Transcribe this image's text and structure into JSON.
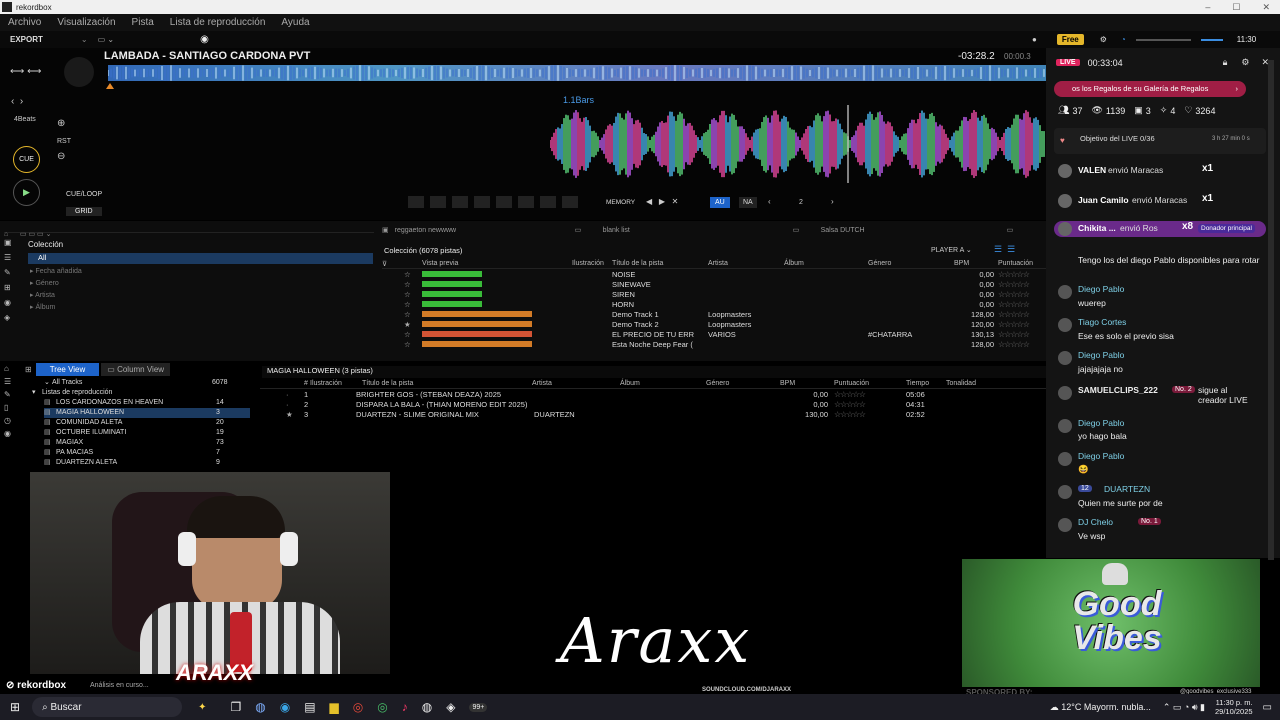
{
  "window": {
    "title": "rekordbox",
    "controls": [
      "–",
      "☐",
      "✕"
    ]
  },
  "menu": [
    "Archivo",
    "Visualización",
    "Pista",
    "Lista de reproducción",
    "Ayuda"
  ],
  "toolbar": {
    "mode": "EXPORT",
    "badge": "Free",
    "clock": "11:30"
  },
  "deck": {
    "track_title": "LAMBADA - SANTIAGO CARDONA PVT",
    "remaining": "-03:28.2",
    "elapsed": "00:00.3",
    "bars_label": "1.1Bars",
    "beats_label": "4Beats",
    "rst": "RST",
    "cue_label": "CUE",
    "cue_loop": "CUE/LOOP",
    "grid": "GRID",
    "memory": "MEMORY",
    "au": "AU",
    "na": "NA",
    "page": "2"
  },
  "collection": {
    "title": "Colección",
    "items": [
      "All",
      "Fecha añadida",
      "Género",
      "Artista",
      "Álbum"
    ],
    "tabs": [
      "reggaeton newwww",
      "blank list",
      "Salsa DUTCH"
    ],
    "count_label": "Colección (6078 pistas)",
    "player": "PLAYER A",
    "columns": [
      "Vista previa",
      "Ilustración",
      "Título de la pista",
      "Artista",
      "Álbum",
      "Género",
      "BPM",
      "Puntuación"
    ],
    "rows": [
      {
        "title": "NOISE",
        "artist": "",
        "genre": "",
        "bpm": "0,00",
        "wave": "#3ecf3e"
      },
      {
        "title": "SINEWAVE",
        "artist": "",
        "genre": "",
        "bpm": "0,00",
        "wave": "#3ecf3e"
      },
      {
        "title": "SIREN",
        "artist": "",
        "genre": "",
        "bpm": "0,00",
        "wave": "#3ecf3e"
      },
      {
        "title": "HORN",
        "artist": "",
        "genre": "",
        "bpm": "0,00",
        "wave": "#3ecf3e"
      },
      {
        "title": "Demo Track 1",
        "artist": "Loopmasters",
        "genre": "",
        "bpm": "128,00",
        "wave": "#e8872a"
      },
      {
        "title": "Demo Track 2",
        "artist": "Loopmasters",
        "genre": "",
        "bpm": "120,00",
        "wave": "#e8872a"
      },
      {
        "title": "EL PRECIO DE TU ERR",
        "artist": "VARIOS",
        "genre": "#CHATARRA",
        "bpm": "130,13",
        "wave": "#e85c3a"
      },
      {
        "title": "Esta Noche Deep Fear (",
        "artist": "",
        "genre": "",
        "bpm": "128,00",
        "wave": "#e8872a"
      }
    ]
  },
  "playlists": {
    "tree_view": "Tree View",
    "column_view": "Column View",
    "all_tracks": "All Tracks",
    "all_count": "6078",
    "lists_label": "Listas de reproducción",
    "items": [
      {
        "name": "LOS CARDONAZOS EN HEAVEN",
        "count": "14"
      },
      {
        "name": "MAGIA HALLOWEEN",
        "count": "3"
      },
      {
        "name": "COMUNIDAD ALETA",
        "count": "20"
      },
      {
        "name": "OCTUBRE ILUMINATI",
        "count": "19"
      },
      {
        "name": "MAGIAX",
        "count": "73"
      },
      {
        "name": "PA MACIAS",
        "count": "7"
      },
      {
        "name": "DUARTEZN ALETA",
        "count": "9"
      }
    ],
    "current": "MAGIA HALLOWEEN (3 pistas)",
    "columns": [
      "#",
      "Ilustración",
      "Título de la pista",
      "Artista",
      "Álbum",
      "Género",
      "BPM",
      "Puntuación",
      "Tiempo",
      "Tonalidad"
    ],
    "rows": [
      {
        "n": "1",
        "title": "BRIGHTER GOS - (STEBAN DEAZA) 2025",
        "artist": "",
        "bpm": "0,00",
        "time": "05:06"
      },
      {
        "n": "2",
        "title": "DISPARA LA BALA - (THIAN MORENO EDIT 2025)",
        "artist": "",
        "bpm": "0,00",
        "time": "04:31"
      },
      {
        "n": "3",
        "title": "DUARTEZN - SLIME ORIGINAL MIX",
        "artist": "DUARTEZN",
        "bpm": "130,00",
        "time": "02:52"
      }
    ]
  },
  "live": {
    "badge": "LIVE",
    "timer": "00:33:04",
    "banner": "os los Regalos de su Galería de Regalos",
    "stats": [
      "37",
      "1139",
      "3",
      "4",
      "3264"
    ],
    "objective": "Objetivo del LIVE 0/36",
    "objective_time": "3 h 27 min 0 s",
    "gifts": [
      {
        "user": "VALEN",
        "text": "envió Maracas",
        "mult": "x1"
      },
      {
        "user": "Juan Camilo",
        "text": "envió Maracas",
        "mult": "x1"
      },
      {
        "user": "Chikita ...",
        "text": "envió Ros",
        "mult": "x8",
        "tag": "Donador principal"
      }
    ],
    "chat": [
      {
        "name": "",
        "text": "Tengo los del diego Pablo disponibles para rotar"
      },
      {
        "name": "Diego Pablo",
        "text": "wuerep"
      },
      {
        "name": "Tiago Cortes",
        "text": "Ese es solo el previo sisa"
      },
      {
        "name": "Diego Pablo",
        "text": "jajajajaja no"
      },
      {
        "name": "SAMUELCLIPS_222",
        "text": "sigue al creador LIVE",
        "badge": "No. 2"
      },
      {
        "name": "Diego Pablo",
        "text": "yo hago bala"
      },
      {
        "name": "Diego Pablo",
        "text": "😆"
      },
      {
        "name": "DUARTEZN",
        "text": "Quien me surte por de",
        "level": "12"
      },
      {
        "name": "DJ Chelo",
        "text": "Ve wsp",
        "badge": "No. 1"
      }
    ]
  },
  "overlay": {
    "logo_text": "Araxx",
    "soundcloud": "SOUNDCLOUD.COM/DJARAXX",
    "goodvibes": "Good Vibes",
    "sponsored": "SPONSORED BY:",
    "sponsor_handle": "@goodvibes_exclusive333",
    "rekordbox_brand": "rekordbox",
    "analysis": "Análisis en curso..."
  },
  "taskbar": {
    "search": "Buscar",
    "weather": "12°C  Mayorm. nubla...",
    "time": "11:30 p. m.",
    "date": "29/10/2025",
    "badge": "99+"
  }
}
